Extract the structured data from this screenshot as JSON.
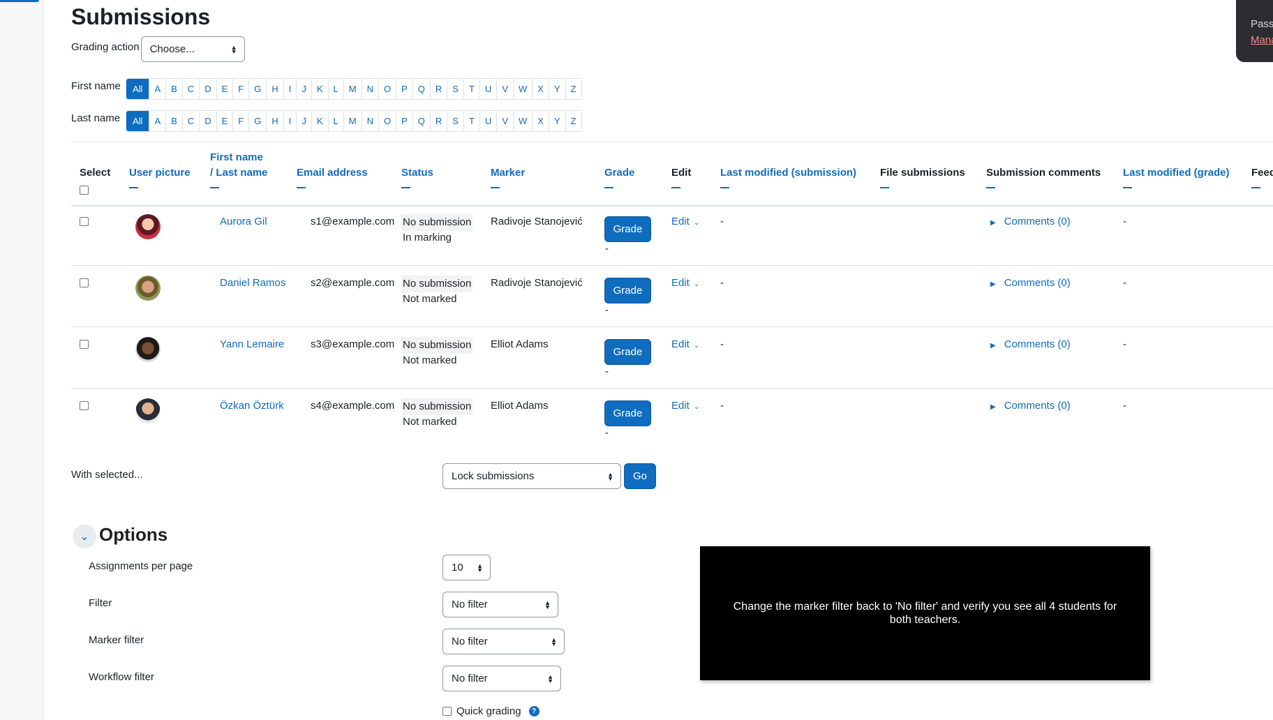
{
  "page": {
    "title": "Submissions"
  },
  "grading_action": {
    "label": "Grading action",
    "selected": "Choose..."
  },
  "initials": {
    "first_name_label": "First name",
    "last_name_label": "Last name",
    "letters": [
      "All",
      "A",
      "B",
      "C",
      "D",
      "E",
      "F",
      "G",
      "H",
      "I",
      "J",
      "K",
      "L",
      "M",
      "N",
      "O",
      "P",
      "Q",
      "R",
      "S",
      "T",
      "U",
      "V",
      "W",
      "X",
      "Y",
      "Z"
    ]
  },
  "table": {
    "headers": {
      "select": "Select",
      "user_picture": "User picture",
      "first_name": "First name",
      "last_name": "/ Last name",
      "email": "Email address",
      "status": "Status",
      "marker": "Marker",
      "grade": "Grade",
      "edit": "Edit",
      "last_modified_submission": "Last modified (submission)",
      "file_submissions": "File submissions",
      "submission_comments": "Submission comments",
      "last_modified_grade": "Last modified (grade)",
      "feedback": "Feed"
    },
    "rows": [
      {
        "name": "Aurora Gil",
        "email": "s1@example.com",
        "status": "No submission",
        "workflow": "In marking",
        "marker": "Radivoje Stanojević",
        "grade_button": "Grade",
        "grade_value": "-",
        "edit": "Edit",
        "last_modified_submission": "-",
        "comments": "Comments (0)",
        "last_modified_grade": "-"
      },
      {
        "name": "Daniel Ramos",
        "email": "s2@example.com",
        "status": "No submission",
        "workflow": "Not marked",
        "marker": "Radivoje Stanojević",
        "grade_button": "Grade",
        "grade_value": "-",
        "edit": "Edit",
        "last_modified_submission": "-",
        "comments": "Comments (0)",
        "last_modified_grade": "-"
      },
      {
        "name": "Yann Lemaire",
        "email": "s3@example.com",
        "status": "No submission",
        "workflow": "Not marked",
        "marker": "Elliot Adams",
        "grade_button": "Grade",
        "grade_value": "-",
        "edit": "Edit",
        "last_modified_submission": "-",
        "comments": "Comments (0)",
        "last_modified_grade": "-"
      },
      {
        "name": "Özkan Öztürk",
        "email": "s4@example.com",
        "status": "No submission",
        "workflow": "Not marked",
        "marker": "Elliot Adams",
        "grade_button": "Grade",
        "grade_value": "-",
        "edit": "Edit",
        "last_modified_submission": "-",
        "comments": "Comments (0)",
        "last_modified_grade": "-"
      }
    ]
  },
  "bulk": {
    "label": "With selected...",
    "selected": "Lock submissions",
    "go": "Go"
  },
  "options": {
    "title": "Options",
    "per_page": {
      "label": "Assignments per page",
      "value": "10"
    },
    "filter": {
      "label": "Filter",
      "value": "No filter"
    },
    "marker_filter": {
      "label": "Marker filter",
      "value": "No filter"
    },
    "workflow_filter": {
      "label": "Workflow filter",
      "value": "No filter"
    },
    "quick_grading": {
      "label": "Quick grading"
    }
  },
  "overlay": {
    "text": "Change the marker filter back to 'No filter' and verify you see all 4 students for both teachers."
  },
  "popup": {
    "line1": "Pass",
    "line2": "Mana"
  },
  "colors": {
    "accent": "#0f6cbf",
    "overlay_bg": "#000000"
  }
}
